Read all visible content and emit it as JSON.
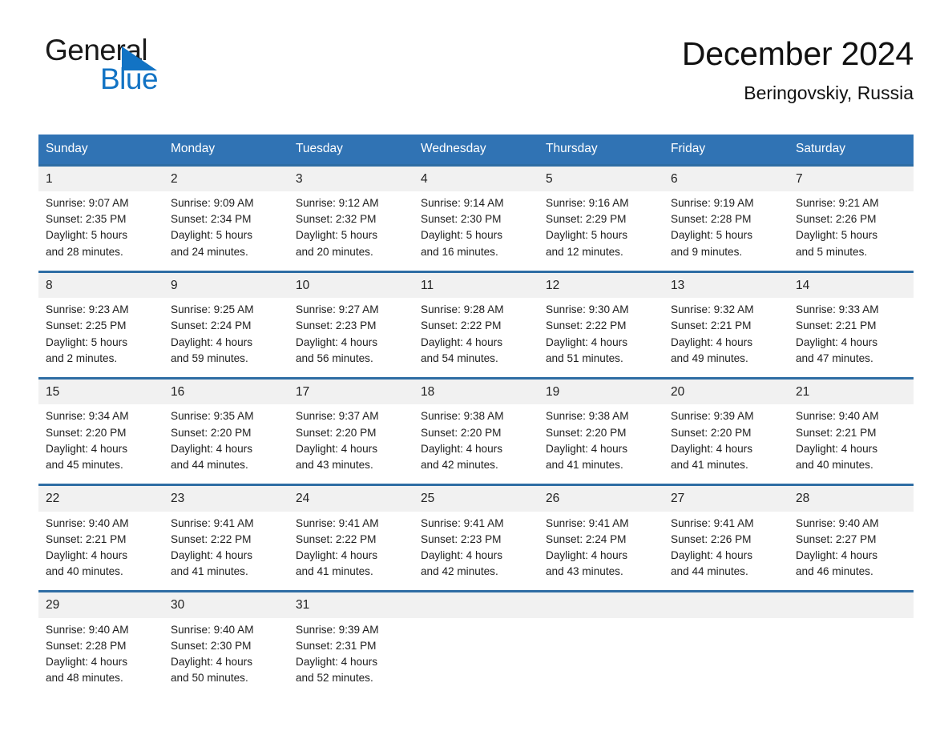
{
  "brand": {
    "word_one": "General",
    "word_two": "Blue",
    "triangle_color": "#1273c4",
    "text_color": "#1a1a1a"
  },
  "header": {
    "title": "December 2024",
    "subtitle": "Beringovskiy, Russia"
  },
  "colors": {
    "header_blue": "#3073b4",
    "row_rule_blue": "#2e6da4",
    "daynum_band": "#f1f1f1",
    "text": "#1d1d1d"
  },
  "weekdays": [
    "Sunday",
    "Monday",
    "Tuesday",
    "Wednesday",
    "Thursday",
    "Friday",
    "Saturday"
  ],
  "weeks": [
    {
      "days": [
        {
          "num": "1",
          "sunrise": "Sunrise: 9:07 AM",
          "sunset": "Sunset: 2:35 PM",
          "daylight1": "Daylight: 5 hours",
          "daylight2": "and 28 minutes."
        },
        {
          "num": "2",
          "sunrise": "Sunrise: 9:09 AM",
          "sunset": "Sunset: 2:34 PM",
          "daylight1": "Daylight: 5 hours",
          "daylight2": "and 24 minutes."
        },
        {
          "num": "3",
          "sunrise": "Sunrise: 9:12 AM",
          "sunset": "Sunset: 2:32 PM",
          "daylight1": "Daylight: 5 hours",
          "daylight2": "and 20 minutes."
        },
        {
          "num": "4",
          "sunrise": "Sunrise: 9:14 AM",
          "sunset": "Sunset: 2:30 PM",
          "daylight1": "Daylight: 5 hours",
          "daylight2": "and 16 minutes."
        },
        {
          "num": "5",
          "sunrise": "Sunrise: 9:16 AM",
          "sunset": "Sunset: 2:29 PM",
          "daylight1": "Daylight: 5 hours",
          "daylight2": "and 12 minutes."
        },
        {
          "num": "6",
          "sunrise": "Sunrise: 9:19 AM",
          "sunset": "Sunset: 2:28 PM",
          "daylight1": "Daylight: 5 hours",
          "daylight2": "and 9 minutes."
        },
        {
          "num": "7",
          "sunrise": "Sunrise: 9:21 AM",
          "sunset": "Sunset: 2:26 PM",
          "daylight1": "Daylight: 5 hours",
          "daylight2": "and 5 minutes."
        }
      ]
    },
    {
      "days": [
        {
          "num": "8",
          "sunrise": "Sunrise: 9:23 AM",
          "sunset": "Sunset: 2:25 PM",
          "daylight1": "Daylight: 5 hours",
          "daylight2": "and 2 minutes."
        },
        {
          "num": "9",
          "sunrise": "Sunrise: 9:25 AM",
          "sunset": "Sunset: 2:24 PM",
          "daylight1": "Daylight: 4 hours",
          "daylight2": "and 59 minutes."
        },
        {
          "num": "10",
          "sunrise": "Sunrise: 9:27 AM",
          "sunset": "Sunset: 2:23 PM",
          "daylight1": "Daylight: 4 hours",
          "daylight2": "and 56 minutes."
        },
        {
          "num": "11",
          "sunrise": "Sunrise: 9:28 AM",
          "sunset": "Sunset: 2:22 PM",
          "daylight1": "Daylight: 4 hours",
          "daylight2": "and 54 minutes."
        },
        {
          "num": "12",
          "sunrise": "Sunrise: 9:30 AM",
          "sunset": "Sunset: 2:22 PM",
          "daylight1": "Daylight: 4 hours",
          "daylight2": "and 51 minutes."
        },
        {
          "num": "13",
          "sunrise": "Sunrise: 9:32 AM",
          "sunset": "Sunset: 2:21 PM",
          "daylight1": "Daylight: 4 hours",
          "daylight2": "and 49 minutes."
        },
        {
          "num": "14",
          "sunrise": "Sunrise: 9:33 AM",
          "sunset": "Sunset: 2:21 PM",
          "daylight1": "Daylight: 4 hours",
          "daylight2": "and 47 minutes."
        }
      ]
    },
    {
      "days": [
        {
          "num": "15",
          "sunrise": "Sunrise: 9:34 AM",
          "sunset": "Sunset: 2:20 PM",
          "daylight1": "Daylight: 4 hours",
          "daylight2": "and 45 minutes."
        },
        {
          "num": "16",
          "sunrise": "Sunrise: 9:35 AM",
          "sunset": "Sunset: 2:20 PM",
          "daylight1": "Daylight: 4 hours",
          "daylight2": "and 44 minutes."
        },
        {
          "num": "17",
          "sunrise": "Sunrise: 9:37 AM",
          "sunset": "Sunset: 2:20 PM",
          "daylight1": "Daylight: 4 hours",
          "daylight2": "and 43 minutes."
        },
        {
          "num": "18",
          "sunrise": "Sunrise: 9:38 AM",
          "sunset": "Sunset: 2:20 PM",
          "daylight1": "Daylight: 4 hours",
          "daylight2": "and 42 minutes."
        },
        {
          "num": "19",
          "sunrise": "Sunrise: 9:38 AM",
          "sunset": "Sunset: 2:20 PM",
          "daylight1": "Daylight: 4 hours",
          "daylight2": "and 41 minutes."
        },
        {
          "num": "20",
          "sunrise": "Sunrise: 9:39 AM",
          "sunset": "Sunset: 2:20 PM",
          "daylight1": "Daylight: 4 hours",
          "daylight2": "and 41 minutes."
        },
        {
          "num": "21",
          "sunrise": "Sunrise: 9:40 AM",
          "sunset": "Sunset: 2:21 PM",
          "daylight1": "Daylight: 4 hours",
          "daylight2": "and 40 minutes."
        }
      ]
    },
    {
      "days": [
        {
          "num": "22",
          "sunrise": "Sunrise: 9:40 AM",
          "sunset": "Sunset: 2:21 PM",
          "daylight1": "Daylight: 4 hours",
          "daylight2": "and 40 minutes."
        },
        {
          "num": "23",
          "sunrise": "Sunrise: 9:41 AM",
          "sunset": "Sunset: 2:22 PM",
          "daylight1": "Daylight: 4 hours",
          "daylight2": "and 41 minutes."
        },
        {
          "num": "24",
          "sunrise": "Sunrise: 9:41 AM",
          "sunset": "Sunset: 2:22 PM",
          "daylight1": "Daylight: 4 hours",
          "daylight2": "and 41 minutes."
        },
        {
          "num": "25",
          "sunrise": "Sunrise: 9:41 AM",
          "sunset": "Sunset: 2:23 PM",
          "daylight1": "Daylight: 4 hours",
          "daylight2": "and 42 minutes."
        },
        {
          "num": "26",
          "sunrise": "Sunrise: 9:41 AM",
          "sunset": "Sunset: 2:24 PM",
          "daylight1": "Daylight: 4 hours",
          "daylight2": "and 43 minutes."
        },
        {
          "num": "27",
          "sunrise": "Sunrise: 9:41 AM",
          "sunset": "Sunset: 2:26 PM",
          "daylight1": "Daylight: 4 hours",
          "daylight2": "and 44 minutes."
        },
        {
          "num": "28",
          "sunrise": "Sunrise: 9:40 AM",
          "sunset": "Sunset: 2:27 PM",
          "daylight1": "Daylight: 4 hours",
          "daylight2": "and 46 minutes."
        }
      ]
    },
    {
      "days": [
        {
          "num": "29",
          "sunrise": "Sunrise: 9:40 AM",
          "sunset": "Sunset: 2:28 PM",
          "daylight1": "Daylight: 4 hours",
          "daylight2": "and 48 minutes."
        },
        {
          "num": "30",
          "sunrise": "Sunrise: 9:40 AM",
          "sunset": "Sunset: 2:30 PM",
          "daylight1": "Daylight: 4 hours",
          "daylight2": "and 50 minutes."
        },
        {
          "num": "31",
          "sunrise": "Sunrise: 9:39 AM",
          "sunset": "Sunset: 2:31 PM",
          "daylight1": "Daylight: 4 hours",
          "daylight2": "and 52 minutes."
        },
        {
          "num": "",
          "sunrise": "",
          "sunset": "",
          "daylight1": "",
          "daylight2": ""
        },
        {
          "num": "",
          "sunrise": "",
          "sunset": "",
          "daylight1": "",
          "daylight2": ""
        },
        {
          "num": "",
          "sunrise": "",
          "sunset": "",
          "daylight1": "",
          "daylight2": ""
        },
        {
          "num": "",
          "sunrise": "",
          "sunset": "",
          "daylight1": "",
          "daylight2": ""
        }
      ]
    }
  ]
}
